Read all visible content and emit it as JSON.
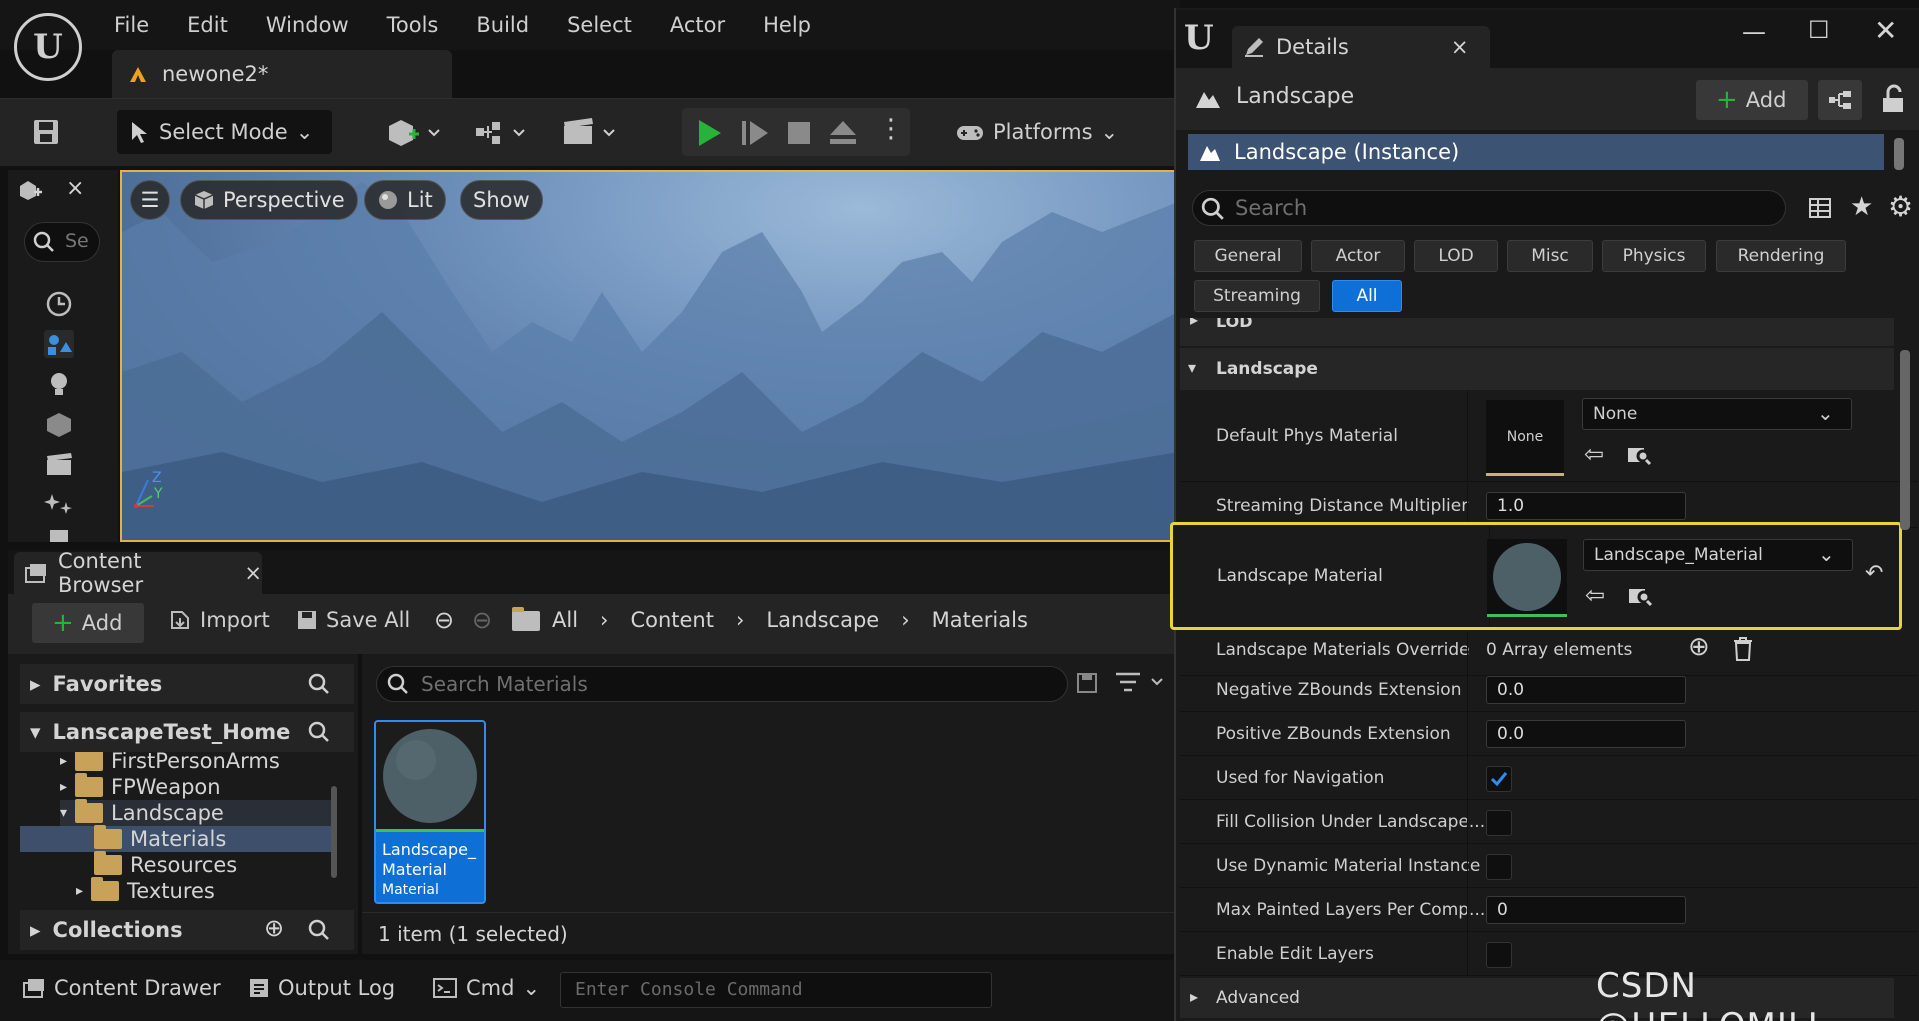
{
  "menu": [
    "File",
    "Edit",
    "Window",
    "Tools",
    "Build",
    "Select",
    "Actor",
    "Help"
  ],
  "document_tab": "newone2*",
  "toolbar": {
    "select_mode": "Select Mode",
    "platforms": "Platforms"
  },
  "modes_panel": {
    "search_placeholder": "Se"
  },
  "viewport": {
    "perspective": "Perspective",
    "lit": "Lit",
    "show": "Show",
    "axis_z": "Z",
    "axis_y": "Y"
  },
  "content_browser": {
    "tab": "Content Browser",
    "add": "Add",
    "import": "Import",
    "save_all": "Save All",
    "breadcrumb": [
      "All",
      "Content",
      "Landscape",
      "Materials"
    ],
    "favorites": "Favorites",
    "project": "LanscapeTest_Home",
    "tree": [
      "FirstPersonArms",
      "FPWeapon",
      "Landscape",
      "Materials",
      "Resources",
      "Textures"
    ],
    "collections": "Collections",
    "search_placeholder": "Search Materials",
    "asset": {
      "name_line1": "Landscape_",
      "name_line2": "Material",
      "type": "Material"
    },
    "status": "1 item (1 selected)"
  },
  "statusbar": {
    "content_drawer": "Content Drawer",
    "output_log": "Output Log",
    "cmd": "Cmd",
    "console_placeholder": "Enter Console Command"
  },
  "details": {
    "tab": "Details",
    "actor_name": "Landscape",
    "add": "Add",
    "instance": "Landscape (Instance)",
    "search_placeholder": "Search",
    "filters": [
      "General",
      "Actor",
      "LOD",
      "Misc",
      "Physics",
      "Rendering",
      "Streaming",
      "All"
    ],
    "section_lod": "LOD",
    "section_landscape": "Landscape",
    "default_phys_material": {
      "label": "Default Phys Material",
      "thumb": "None",
      "value": "None"
    },
    "streaming_distance": {
      "label": "Streaming Distance Multiplier",
      "value": "1.0"
    },
    "landscape_material": {
      "label": "Landscape Material",
      "value": "Landscape_Material"
    },
    "materials_override": {
      "label": "Landscape Materials Override",
      "value": "0 Array elements"
    },
    "neg_zbounds": {
      "label": "Negative ZBounds Extension",
      "value": "0.0"
    },
    "pos_zbounds": {
      "label": "Positive ZBounds Extension",
      "value": "0.0"
    },
    "used_for_navigation": {
      "label": "Used for Navigation",
      "checked": true
    },
    "fill_collision": {
      "label": "Fill Collision Under Landscape...",
      "checked": false
    },
    "dynamic_material": {
      "label": "Use Dynamic Material Instance",
      "checked": false
    },
    "max_painted_layers": {
      "label": "Max Painted Layers Per Comp...",
      "value": "0"
    },
    "enable_edit_layers": {
      "label": "Enable Edit Layers",
      "checked": false
    },
    "section_advanced": "Advanced"
  },
  "watermark": "CSDN @HELLOMILI",
  "colors": {
    "accent_blue": "#0e6fd6",
    "highlight_yellow": "#e8d53a",
    "play_green": "#27b33a",
    "folder": "#c9a25a"
  }
}
